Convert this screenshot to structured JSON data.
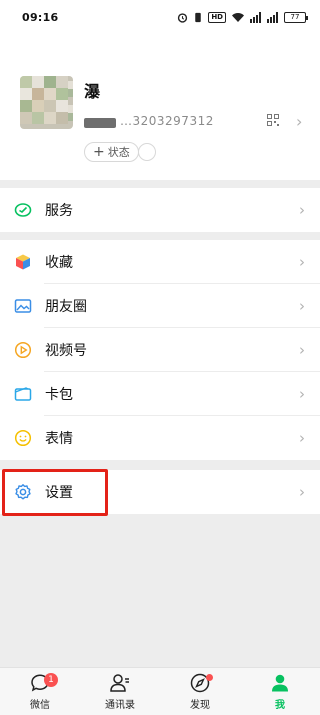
{
  "status_bar": {
    "time": "09:16",
    "hd_label": "HD",
    "battery_level": "77"
  },
  "profile": {
    "nickname": "瀑",
    "wechat_id": "…3203297312",
    "status_label": "状态"
  },
  "menu": {
    "services": "服务",
    "favorites": "收藏",
    "moments": "朋友圈",
    "channels": "视频号",
    "cards": "卡包",
    "stickers": "表情",
    "settings": "设置"
  },
  "bottom_nav": {
    "chats": "微信",
    "chats_badge": "1",
    "contacts": "通讯录",
    "discover": "发现",
    "me": "我"
  },
  "colors": {
    "accent": "#07c160",
    "badge": "#fa5151",
    "highlight": "#e32218"
  }
}
